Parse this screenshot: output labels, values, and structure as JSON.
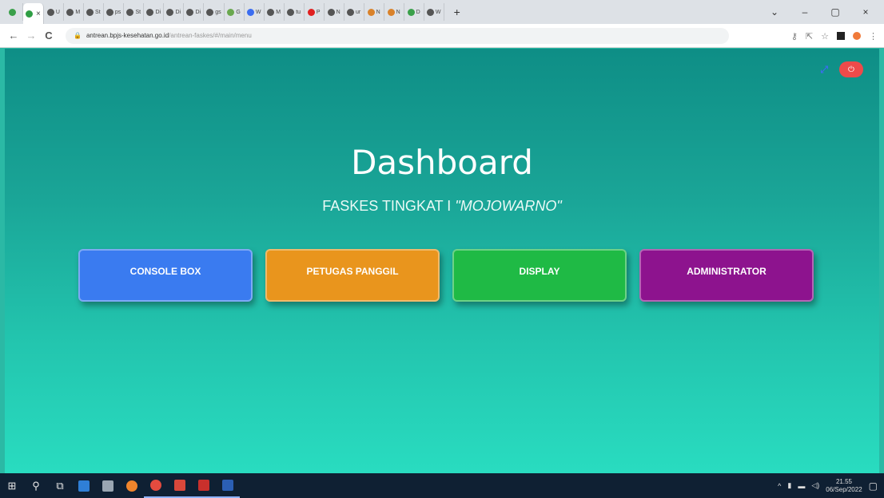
{
  "browser": {
    "tabs": [
      {
        "label": "",
        "color": "#3aa04a"
      },
      {
        "label": "",
        "color": "#2f9e44",
        "active": true,
        "close": "×"
      },
      {
        "label": "U",
        "color": "#555"
      },
      {
        "label": "M",
        "color": "#555"
      },
      {
        "label": "St",
        "color": "#555"
      },
      {
        "label": "ps",
        "color": "#555"
      },
      {
        "label": "St",
        "color": "#555"
      },
      {
        "label": "Di",
        "color": "#555"
      },
      {
        "label": "Di",
        "color": "#555"
      },
      {
        "label": "Di",
        "color": "#555"
      },
      {
        "label": "gs",
        "color": "#555"
      },
      {
        "label": "G",
        "color": "#6aa84f"
      },
      {
        "label": "W",
        "color": "#3b6df0"
      },
      {
        "label": "M",
        "color": "#555"
      },
      {
        "label": "tu",
        "color": "#555"
      },
      {
        "label": "P",
        "color": "#e02020"
      },
      {
        "label": "N",
        "color": "#555"
      },
      {
        "label": "ur",
        "color": "#555"
      },
      {
        "label": "N",
        "color": "#d9822b"
      },
      {
        "label": "N",
        "color": "#d9822b"
      },
      {
        "label": "D",
        "color": "#3aa04a"
      },
      {
        "label": "W",
        "color": "#555"
      }
    ],
    "new_tab": "+",
    "window_controls": [
      "⌄",
      "–",
      "▢",
      "×"
    ],
    "nav": {
      "back": "←",
      "forward": "→",
      "reload": "C"
    },
    "url_host": "antrean.bpjs-kesehatan.go.id",
    "url_path": "/antrean-faskes/#/main/menu",
    "lock_icon": "🔒"
  },
  "page": {
    "title": "Dashboard",
    "subtitle_prefix": "FASKES TINGKAT I",
    "faskes_name": "\"MOJOWARNO\"",
    "expand_icon": "⤢",
    "power_icon": "⏻",
    "menu": {
      "console_box": "CONSOLE BOX",
      "petugas_panggil": "PETUGAS PANGGIL",
      "display": "DISPLAY",
      "administrator": "ADMINISTRATOR"
    }
  },
  "taskbar": {
    "clock_time": "21.55",
    "clock_date": "06/Sep/2022",
    "tray_arrow": "^"
  },
  "colors": {
    "console_box": "#3a7bf0",
    "petugas_panggil": "#e9951d",
    "display": "#1fba45",
    "administrator": "#8d138e",
    "power": "#ee4a4a"
  }
}
